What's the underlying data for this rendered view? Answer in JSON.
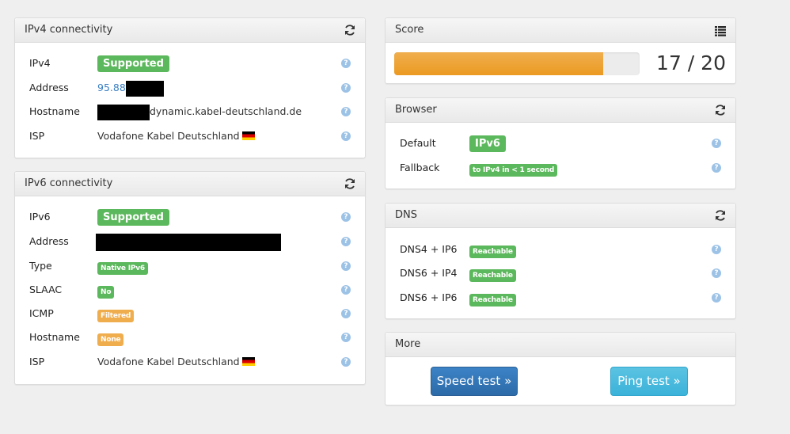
{
  "ipv4_panel": {
    "title": "IPv4 connectivity",
    "refresh_icon": "refresh-icon",
    "rows": [
      {
        "label": "IPv4",
        "badge": "Supported",
        "badge_color": "#5cb85c"
      },
      {
        "label": "Address",
        "value_visible": "95.88",
        "redacted": true
      },
      {
        "label": "Hostname",
        "value_visible": "dynamic.kabel-deutschland.de",
        "redacted": true
      },
      {
        "label": "ISP",
        "value": "Vodafone Kabel Deutschland",
        "flag": "de-flag-icon"
      }
    ]
  },
  "ipv6_panel": {
    "title": "IPv6 connectivity",
    "refresh_icon": "refresh-icon",
    "rows": [
      {
        "label": "IPv6",
        "badge": "Supported",
        "badge_color": "#5cb85c"
      },
      {
        "label": "Address",
        "redacted": true
      },
      {
        "label": "Type",
        "badge": "Native IPv6",
        "badge_color": "#5cb85c"
      },
      {
        "label": "SLAAC",
        "badge": "No",
        "badge_color": "#5cb85c"
      },
      {
        "label": "ICMP",
        "badge": "Filtered",
        "badge_color": "#f0ad4e"
      },
      {
        "label": "Hostname",
        "badge": "None",
        "badge_color": "#f0ad4e"
      },
      {
        "label": "ISP",
        "value": "Vodafone Kabel Deutschland",
        "flag": "de-flag-icon"
      }
    ]
  },
  "score_panel": {
    "title": "Score",
    "list_icon": "list-icon",
    "score": 17,
    "max": 20,
    "score_text": "17 / 20",
    "progress_fraction": 0.85,
    "bar_color": "#f0ad4e"
  },
  "browser_panel": {
    "title": "Browser",
    "refresh_icon": "refresh-icon",
    "rows": [
      {
        "label": "Default",
        "badge": "IPv6",
        "badge_color": "#5cb85c"
      },
      {
        "label": "Fallback",
        "badge": "to IPv4 in < 1 second",
        "badge_color": "#5cb85c"
      }
    ]
  },
  "dns_panel": {
    "title": "DNS",
    "refresh_icon": "refresh-icon",
    "rows": [
      {
        "label": "DNS4 + IP6",
        "badge": "Reachable",
        "badge_color": "#5cb85c"
      },
      {
        "label": "DNS6 + IP4",
        "badge": "Reachable",
        "badge_color": "#5cb85c"
      },
      {
        "label": "DNS6 + IP6",
        "badge": "Reachable",
        "badge_color": "#5cb85c"
      }
    ]
  },
  "more_panel": {
    "title": "More",
    "speed_test_label": "Speed test »",
    "ping_test_label": "Ping test »"
  },
  "help_glyph": "?"
}
